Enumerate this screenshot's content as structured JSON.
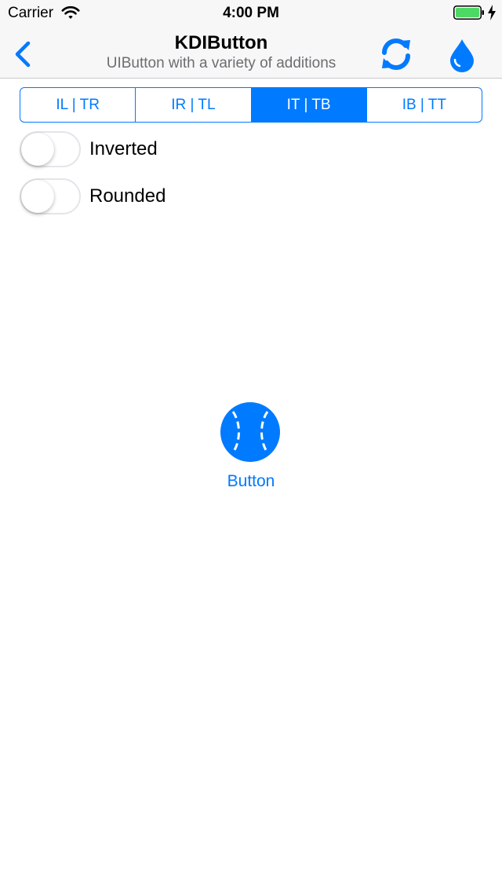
{
  "status_bar": {
    "carrier": "Carrier",
    "time": "4:00 PM",
    "battery": "charging"
  },
  "nav": {
    "title": "KDIButton",
    "subtitle": "UIButton with a variety of additions"
  },
  "segments": {
    "items": [
      "IL | TR",
      "IR | TL",
      "IT | TB",
      "IB | TT"
    ],
    "selected": "IT | TB"
  },
  "switches": {
    "inverted": {
      "label": "Inverted",
      "on": false
    },
    "rounded": {
      "label": "Rounded",
      "on": false
    }
  },
  "demo_button": {
    "title": "Button",
    "icon": "baseball-icon"
  },
  "colors": {
    "accent": "#007aff",
    "bar_bg": "#f7f7f7",
    "battery": "#4cd964"
  }
}
